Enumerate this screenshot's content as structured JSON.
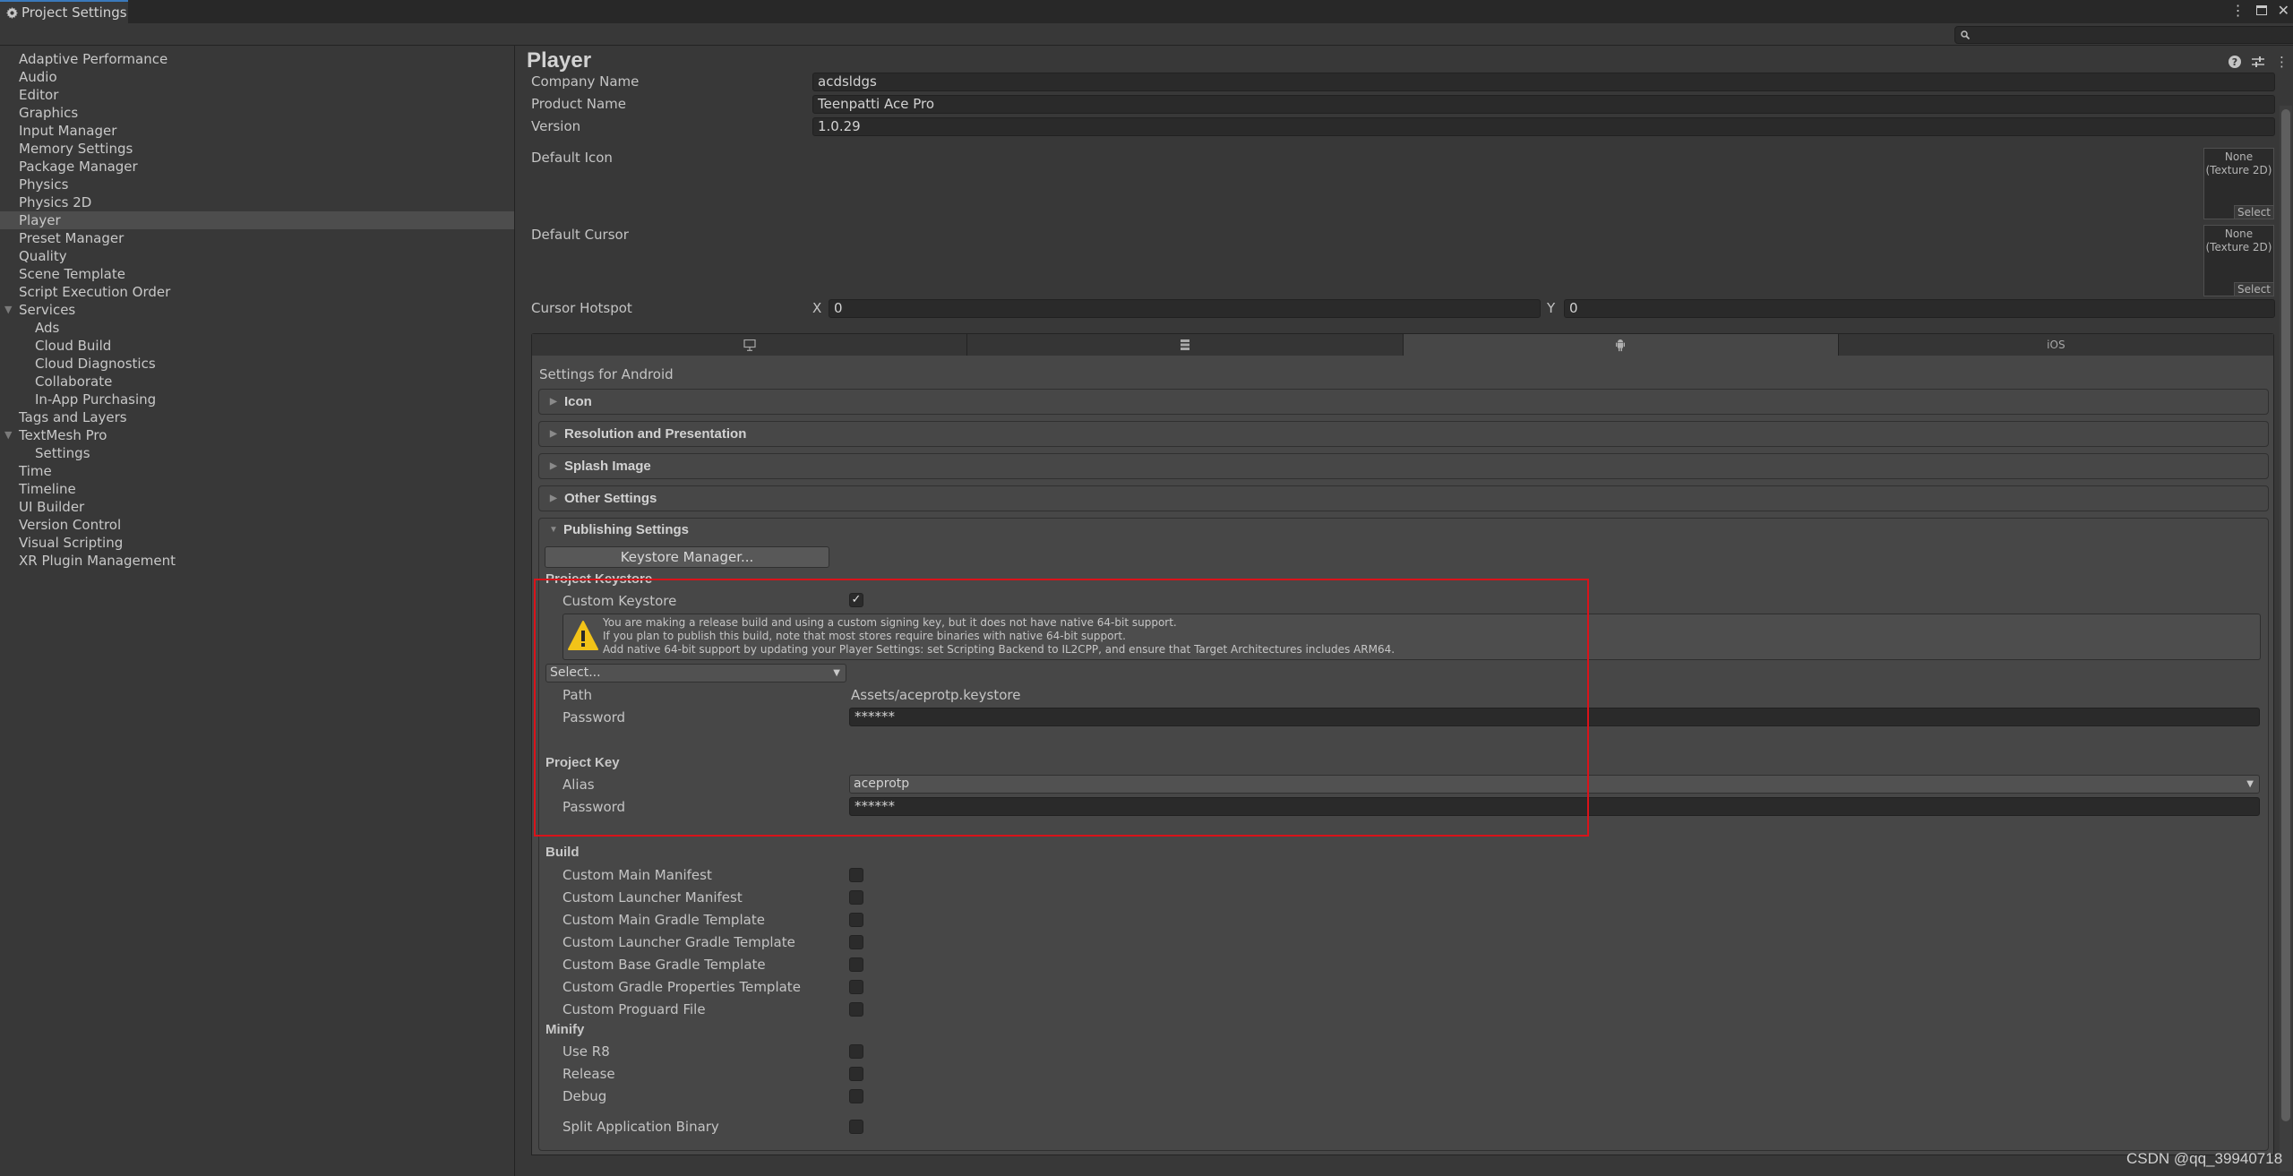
{
  "window": {
    "tab_title": "Project Settings",
    "tab_icon": "gear-icon",
    "controls": [
      "more-vertical-icon",
      "maximize-icon",
      "close-icon"
    ]
  },
  "search": {
    "placeholder": "",
    "value": ""
  },
  "sidebar": {
    "items": [
      {
        "label": "Adaptive Performance",
        "level": 0
      },
      {
        "label": "Audio",
        "level": 0
      },
      {
        "label": "Editor",
        "level": 0
      },
      {
        "label": "Graphics",
        "level": 0
      },
      {
        "label": "Input Manager",
        "level": 0
      },
      {
        "label": "Memory Settings",
        "level": 0
      },
      {
        "label": "Package Manager",
        "level": 0
      },
      {
        "label": "Physics",
        "level": 0
      },
      {
        "label": "Physics 2D",
        "level": 0
      },
      {
        "label": "Player",
        "level": 0,
        "selected": true
      },
      {
        "label": "Preset Manager",
        "level": 0
      },
      {
        "label": "Quality",
        "level": 0
      },
      {
        "label": "Scene Template",
        "level": 0
      },
      {
        "label": "Script Execution Order",
        "level": 0
      },
      {
        "label": "Services",
        "level": 0,
        "expanded": true
      },
      {
        "label": "Ads",
        "level": 1
      },
      {
        "label": "Cloud Build",
        "level": 1
      },
      {
        "label": "Cloud Diagnostics",
        "level": 1
      },
      {
        "label": "Collaborate",
        "level": 1
      },
      {
        "label": "In-App Purchasing",
        "level": 1
      },
      {
        "label": "Tags and Layers",
        "level": 0
      },
      {
        "label": "TextMesh Pro",
        "level": 0,
        "expanded": true
      },
      {
        "label": "Settings",
        "level": 1
      },
      {
        "label": "Time",
        "level": 0
      },
      {
        "label": "Timeline",
        "level": 0
      },
      {
        "label": "UI Builder",
        "level": 0
      },
      {
        "label": "Version Control",
        "level": 0
      },
      {
        "label": "Visual Scripting",
        "level": 0
      },
      {
        "label": "XR Plugin Management",
        "level": 0
      }
    ]
  },
  "player": {
    "title": "Player",
    "header_icons": [
      "help-icon",
      "presets-icon",
      "more-vertical-icon"
    ],
    "company_name_label": "Company Name",
    "company_name": "acdsldgs",
    "product_name_label": "Product Name",
    "product_name": "Teenpatti Ace Pro",
    "version_label": "Version",
    "version": "1.0.29",
    "default_icon_label": "Default Icon",
    "default_cursor_label": "Default Cursor",
    "texture_none_line1": "None",
    "texture_none_line2": "(Texture 2D)",
    "texture_select": "Select",
    "cursor_hotspot_label": "Cursor Hotspot",
    "hotspot_x_label": "X",
    "hotspot_x": "0",
    "hotspot_y_label": "Y",
    "hotspot_y": "0"
  },
  "platform_tabs": [
    {
      "name": "standalone",
      "icon": "monitor-icon",
      "label": ""
    },
    {
      "name": "server",
      "icon": "server-icon",
      "label": ""
    },
    {
      "name": "android",
      "icon": "android-icon",
      "label": "",
      "active": true
    },
    {
      "name": "ios",
      "icon": "",
      "label": "iOS"
    }
  ],
  "settings_for": "Settings for Android",
  "foldouts": [
    {
      "label": "Icon",
      "expanded": false
    },
    {
      "label": "Resolution and Presentation",
      "expanded": false
    },
    {
      "label": "Splash Image",
      "expanded": false
    },
    {
      "label": "Other Settings",
      "expanded": false
    },
    {
      "label": "Publishing Settings",
      "expanded": true
    }
  ],
  "publishing": {
    "keystore_manager_button": "Keystore Manager...",
    "project_keystore_header": "Project Keystore",
    "custom_keystore_label": "Custom Keystore",
    "custom_keystore_checked": true,
    "warning_lines": [
      "You are making a release build and using a custom signing key, but it does not have native 64-bit support.",
      "If you plan to publish this build, note that most stores require binaries with native 64-bit support.",
      "Add native 64-bit support by updating your Player Settings: set Scripting Backend to IL2CPP, and ensure that Target Architectures includes ARM64."
    ],
    "keystore_select": "Select...",
    "path_label": "Path",
    "path_value": "Assets/aceprotp.keystore",
    "keystore_password_label": "Password",
    "keystore_password": "******",
    "project_key_header": "Project Key",
    "alias_label": "Alias",
    "alias_value": "aceprotp",
    "key_password_label": "Password",
    "key_password": "******",
    "build_header": "Build",
    "build_options": [
      {
        "label": "Custom Main Manifest",
        "checked": false
      },
      {
        "label": "Custom Launcher Manifest",
        "checked": false
      },
      {
        "label": "Custom Main Gradle Template",
        "checked": false
      },
      {
        "label": "Custom Launcher Gradle Template",
        "checked": false
      },
      {
        "label": "Custom Base Gradle Template",
        "checked": false
      },
      {
        "label": "Custom Gradle Properties Template",
        "checked": false
      },
      {
        "label": "Custom Proguard File",
        "checked": false
      }
    ],
    "minify_header": "Minify",
    "minify_options": [
      {
        "label": "Use R8",
        "checked": false
      },
      {
        "label": "Release",
        "checked": false
      },
      {
        "label": "Debug",
        "checked": false
      }
    ],
    "split_binary_label": "Split Application Binary",
    "split_binary_checked": false
  },
  "annotation_color": "#d9131a",
  "watermark": "CSDN @qq_39940718"
}
